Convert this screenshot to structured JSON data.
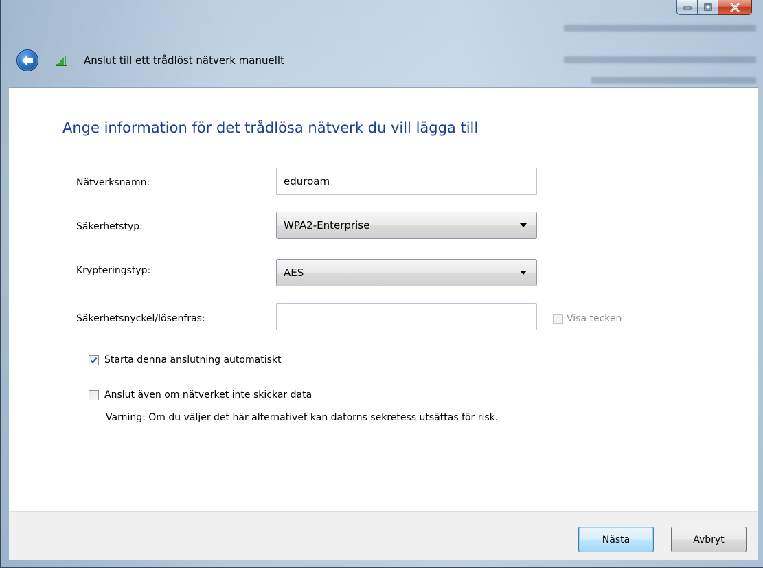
{
  "window": {
    "title": "Anslut till ett trådlöst nätverk manuellt"
  },
  "heading": "Ange information för det trådlösa nätverk du vill lägga till",
  "form": {
    "network_name_label": "Nätverksnamn:",
    "network_name_value": "eduroam",
    "security_type_label": "Säkerhetstyp:",
    "security_type_value": "WPA2-Enterprise",
    "encryption_type_label": "Krypteringstyp:",
    "encryption_type_value": "AES",
    "security_key_label": "Säkerhetsnyckel/lösenfras:",
    "security_key_value": "",
    "show_chars_label": "Visa tecken",
    "show_chars_checked": false,
    "auto_start_label": "Starta denna anslutning automatiskt",
    "auto_start_checked": true,
    "connect_even_label": "Anslut även om nätverket inte skickar data",
    "connect_even_checked": false,
    "warning_text": "Varning: Om du väljer det här alternativet kan datorns sekretess utsättas för risk."
  },
  "buttons": {
    "next": "Nästa",
    "cancel": "Avbryt"
  },
  "icons": {
    "back": "back-arrow-icon",
    "signal": "wireless-signal-icon",
    "minimize": "minimize-icon",
    "maximize": "maximize-icon",
    "close": "close-icon"
  },
  "colors": {
    "heading": "#1b3f93",
    "close_button": "#c0391c",
    "signal": "#3aa63a"
  }
}
